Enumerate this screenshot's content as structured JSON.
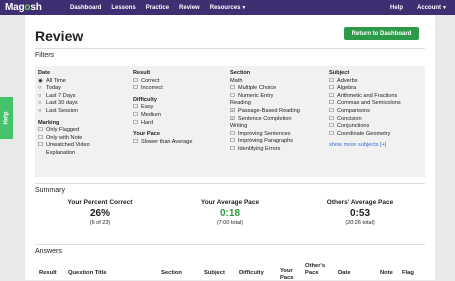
{
  "nav": {
    "logo_before": "Mag",
    "logo_o": "o",
    "logo_after": "sh",
    "links": [
      "Dashboard",
      "Lessons",
      "Practice",
      "Review",
      "Resources"
    ],
    "help": "Help",
    "account": "Account"
  },
  "help_tab": "Help",
  "page": {
    "title": "Review",
    "return_button": "Return to Dashboard"
  },
  "filters": {
    "heading": "Filters",
    "date": {
      "label": "Date",
      "options": [
        "All Time",
        "Today",
        "Last 7 Days",
        "Last 30 days",
        "Last Session"
      ],
      "selected": "All Time"
    },
    "marking": {
      "label": "Marking",
      "options": [
        "Only Flagged",
        "Only with Note",
        "Unwatched Video",
        "Explanation"
      ]
    },
    "result": {
      "label": "Result",
      "options": [
        "Correct",
        "Incorrect"
      ]
    },
    "difficulty": {
      "label": "Difficulty",
      "options": [
        "Easy",
        "Medium",
        "Hard"
      ]
    },
    "your_pace": {
      "label": "Your Pace",
      "options": [
        "Slower than Average"
      ]
    },
    "section": {
      "label": "Section",
      "math_label": "Math",
      "math_options": [
        "Multiple Choice",
        "Numeric Entry"
      ],
      "reading_label": "Reading",
      "reading_options": [
        "Passage-Based Reading",
        "Sentence Completion"
      ],
      "writing_label": "Writing",
      "writing_options": [
        "Improving Sentences",
        "Improving Paragraphs",
        "Identifying Errors"
      ]
    },
    "subject": {
      "label": "Subject",
      "options": [
        "Adverbs",
        "Algebra",
        "Arithmetic and Fractions",
        "Commas and Semicolons",
        "Comparisons",
        "Concision",
        "Conjunctions",
        "Coordinate Geometry"
      ],
      "show_more": "show more subjects [+]"
    }
  },
  "summary": {
    "heading": "Summary",
    "percent_correct": {
      "title": "Your Percent Correct",
      "value": "26%",
      "sub": "(6 of 23)"
    },
    "average_pace": {
      "title": "Your Average Pace",
      "value": "0:18",
      "sub": "(7:00 total)"
    },
    "others_pace": {
      "title": "Others' Average Pace",
      "value": "0:53",
      "sub": "(20:26 total)"
    }
  },
  "answers": {
    "heading": "Answers",
    "columns": [
      "Result",
      "Question Title",
      "Section",
      "Subject",
      "Difficulty",
      "Your Pace",
      "Other's Pace",
      "Date",
      "Note",
      "Flag"
    ]
  }
}
